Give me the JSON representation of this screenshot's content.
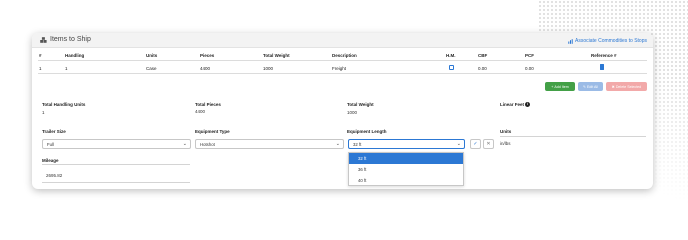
{
  "header": {
    "title": "Items to Ship",
    "associate_link": "Associate Commodities to Stops"
  },
  "table": {
    "headers": [
      "#",
      "Handling",
      "Units",
      "Pieces",
      "Total Weight",
      "Description",
      "H.M.",
      "CBF",
      "PCF",
      "Reference #"
    ],
    "row": {
      "num": "1",
      "handling": "1",
      "units": "Case",
      "pieces": "4400",
      "total_weight": "1000",
      "description": "Freight",
      "hm_checked": false,
      "cbf": "0.00",
      "pcf": "0.00"
    }
  },
  "actions": {
    "add_item": "Add Item",
    "edit_all": "Edit All",
    "delete_selected": "Delete Selected",
    "colors": {
      "add": "#43a047",
      "edit": "#9bbbe6",
      "delete": "#f2a9a9"
    }
  },
  "totals": {
    "handling_units_label": "Total Handling Units",
    "handling_units_value": "1",
    "pieces_label": "Total Pieces",
    "pieces_value": "4400",
    "weight_label": "Total Weight",
    "weight_value": "1000",
    "linear_feet_label": "Linear Feet"
  },
  "fields": {
    "trailer_size_label": "Trailer Size",
    "trailer_size_value": "Full",
    "equipment_type_label": "Equipment Type",
    "equipment_type_value": "Hotshot",
    "equipment_length_label": "Equipment Length",
    "equipment_length_value": "32 ft",
    "units_label": "Units",
    "units_value": "in/lbs",
    "mileage_label": "Mileage",
    "mileage_value": "2695.82"
  },
  "equipment_length_options": [
    "32 ft",
    "36 ft",
    "40 ft"
  ],
  "equipment_length_selected_index": 0,
  "accent_color": "#2c78d4"
}
